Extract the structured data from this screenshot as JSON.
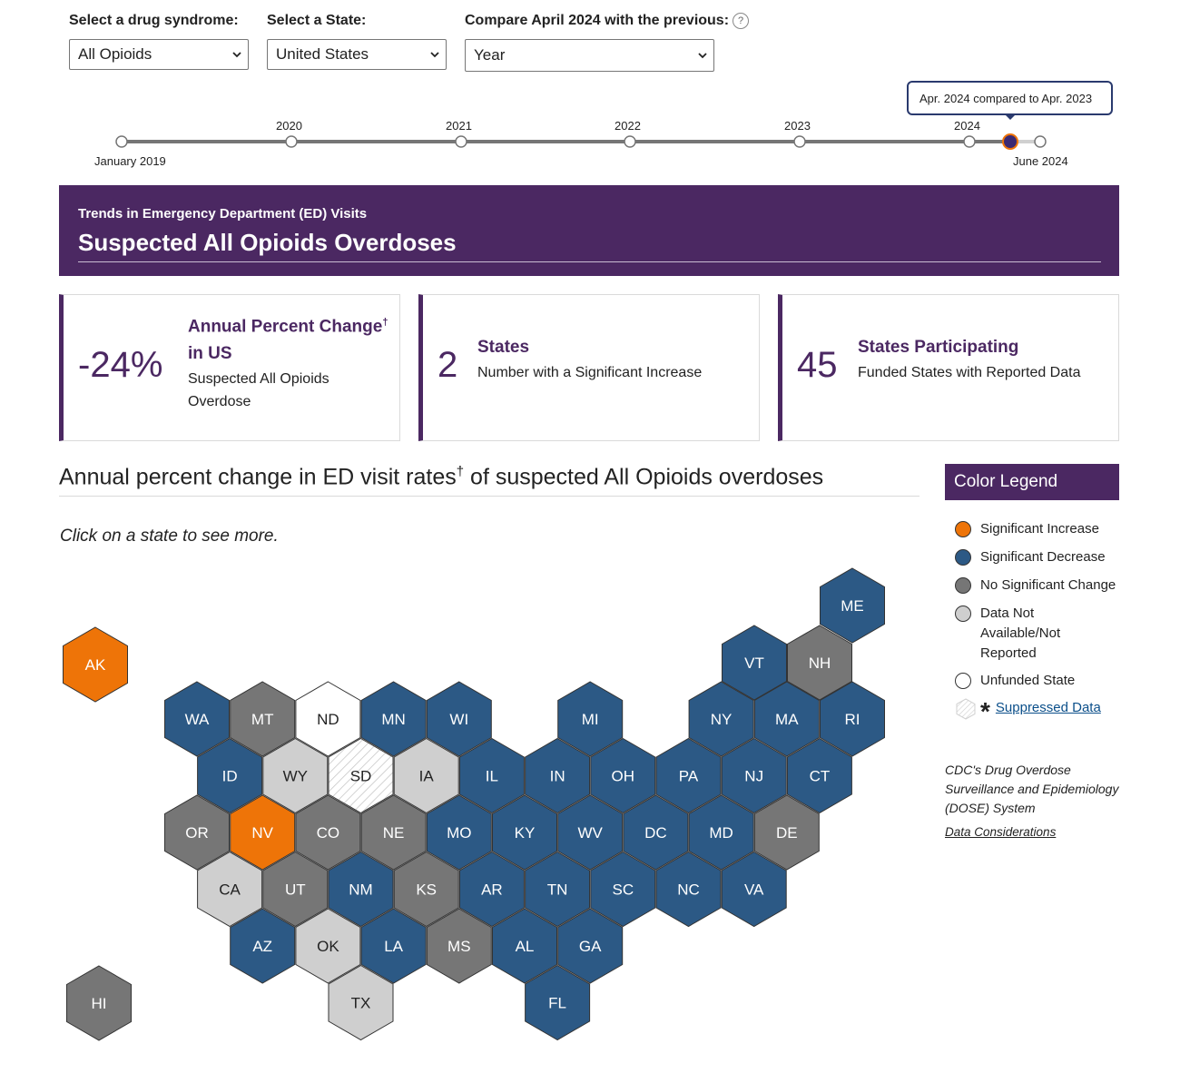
{
  "filters": {
    "drug": {
      "label": "Select a drug syndrome:",
      "value": "All Opioids"
    },
    "state": {
      "label": "Select a State:",
      "value": "United States"
    },
    "compare": {
      "label": "Compare April 2024 with the previous:",
      "value": "Year",
      "help": "?"
    }
  },
  "timeline": {
    "start_label": "January 2019",
    "end_label": "June 2024",
    "years": [
      "2020",
      "2021",
      "2022",
      "2023",
      "2024"
    ],
    "tooltip": "Apr. 2024 compared to Apr. 2023"
  },
  "banner": {
    "subtitle": "Trends in Emergency Department (ED) Visits",
    "title": "Suspected All Opioids Overdoses"
  },
  "cards": [
    {
      "value": "-24%",
      "title": "Annual Percent Change",
      "title_sup": "†",
      "title_line2": "in US",
      "desc_line1": "Suspected All Opioids",
      "desc_line2": "Overdose"
    },
    {
      "value": "2",
      "title": "States",
      "desc": "Number with a Significant Increase"
    },
    {
      "value": "45",
      "title": "States Participating",
      "desc": "Funded States with Reported Data"
    }
  ],
  "map": {
    "heading": "Annual percent change in ED visit rates",
    "heading_sup": "†",
    "heading_tail": " of suspected All Opioids overdoses",
    "instruction": "Click on a state to see more.",
    "states": [
      {
        "code": "AK",
        "status": "increase"
      },
      {
        "code": "HI",
        "status": "nochange"
      },
      {
        "code": "ME",
        "status": "decrease"
      },
      {
        "code": "VT",
        "status": "decrease"
      },
      {
        "code": "NH",
        "status": "nochange"
      },
      {
        "code": "WA",
        "status": "decrease"
      },
      {
        "code": "MT",
        "status": "nochange"
      },
      {
        "code": "ND",
        "status": "unfunded"
      },
      {
        "code": "MN",
        "status": "decrease"
      },
      {
        "code": "WI",
        "status": "decrease"
      },
      {
        "code": "MI",
        "status": "decrease"
      },
      {
        "code": "NY",
        "status": "decrease"
      },
      {
        "code": "MA",
        "status": "decrease"
      },
      {
        "code": "RI",
        "status": "decrease"
      },
      {
        "code": "ID",
        "status": "decrease"
      },
      {
        "code": "WY",
        "status": "na"
      },
      {
        "code": "SD",
        "status": "suppressed"
      },
      {
        "code": "IA",
        "status": "na"
      },
      {
        "code": "IL",
        "status": "decrease"
      },
      {
        "code": "IN",
        "status": "decrease"
      },
      {
        "code": "OH",
        "status": "decrease"
      },
      {
        "code": "PA",
        "status": "decrease"
      },
      {
        "code": "NJ",
        "status": "decrease"
      },
      {
        "code": "CT",
        "status": "decrease"
      },
      {
        "code": "OR",
        "status": "nochange"
      },
      {
        "code": "NV",
        "status": "increase"
      },
      {
        "code": "CO",
        "status": "nochange"
      },
      {
        "code": "NE",
        "status": "nochange"
      },
      {
        "code": "MO",
        "status": "decrease"
      },
      {
        "code": "KY",
        "status": "decrease"
      },
      {
        "code": "WV",
        "status": "decrease"
      },
      {
        "code": "DC",
        "status": "decrease"
      },
      {
        "code": "MD",
        "status": "decrease"
      },
      {
        "code": "DE",
        "status": "nochange"
      },
      {
        "code": "CA",
        "status": "na"
      },
      {
        "code": "UT",
        "status": "nochange"
      },
      {
        "code": "NM",
        "status": "decrease"
      },
      {
        "code": "KS",
        "status": "nochange"
      },
      {
        "code": "AR",
        "status": "decrease"
      },
      {
        "code": "TN",
        "status": "decrease"
      },
      {
        "code": "SC",
        "status": "decrease"
      },
      {
        "code": "NC",
        "status": "decrease"
      },
      {
        "code": "VA",
        "status": "decrease"
      },
      {
        "code": "AZ",
        "status": "decrease"
      },
      {
        "code": "OK",
        "status": "na"
      },
      {
        "code": "LA",
        "status": "decrease"
      },
      {
        "code": "MS",
        "status": "nochange"
      },
      {
        "code": "AL",
        "status": "decrease"
      },
      {
        "code": "GA",
        "status": "decrease"
      },
      {
        "code": "TX",
        "status": "na"
      },
      {
        "code": "FL",
        "status": "decrease"
      }
    ]
  },
  "legend": {
    "title": "Color Legend",
    "items": [
      {
        "label": "Significant Increase",
        "color": "#ee7408"
      },
      {
        "label": "Significant Decrease",
        "color": "#2c5985"
      },
      {
        "label": "No Significant Change",
        "color": "#767676"
      },
      {
        "label_line1": "Data Not",
        "label_line2": "Available/Not",
        "label_line3": "Reported",
        "color": "#cfcfcf"
      },
      {
        "label": "Unfunded State",
        "color": "#ffffff"
      }
    ],
    "suppressed_label": "Suppressed Data",
    "suppressed_symbol": "*",
    "source_line1": "CDC's Drug Overdose",
    "source_line2": "Surveillance and Epidemiology",
    "source_line3": "(DOSE) System",
    "considerations_link": "Data Considerations"
  },
  "colors": {
    "brand_purple": "#4b2862",
    "increase": "#ee7408",
    "decrease": "#2c5985",
    "nochange": "#767676",
    "na": "#cfcfcf",
    "unfunded": "#ffffff"
  }
}
